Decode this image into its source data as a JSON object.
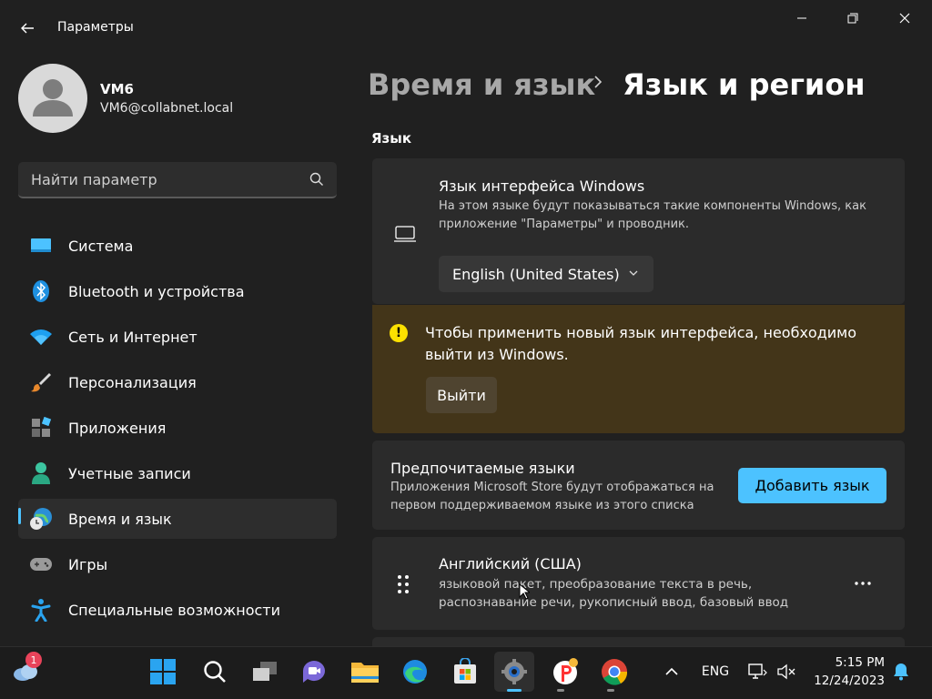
{
  "window": {
    "title": "Параметры",
    "controls": [
      "minimize-icon",
      "maximize-icon",
      "close-icon"
    ]
  },
  "profile": {
    "name": "VM6",
    "email": "VM6@collabnet.local"
  },
  "search": {
    "placeholder": "Найти параметр"
  },
  "nav": {
    "items": [
      {
        "label": "Система",
        "icon": "system-icon"
      },
      {
        "label": "Bluetooth и устройства",
        "icon": "bluetooth-icon"
      },
      {
        "label": "Сеть и Интернет",
        "icon": "wifi-icon"
      },
      {
        "label": "Персонализация",
        "icon": "brush-icon"
      },
      {
        "label": "Приложения",
        "icon": "apps-icon"
      },
      {
        "label": "Учетные записи",
        "icon": "accounts-icon"
      },
      {
        "label": "Время и язык",
        "icon": "time-language-icon",
        "active": true
      },
      {
        "label": "Игры",
        "icon": "gamepad-icon"
      },
      {
        "label": "Специальные возможности",
        "icon": "accessibility-icon"
      }
    ]
  },
  "breadcrumb": {
    "parent": "Время и язык",
    "current": "Язык и регион"
  },
  "language_section": {
    "title": "Язык",
    "display_language": {
      "title": "Язык интерфейса Windows",
      "description": "На этом языке будут показываться такие компоненты Windows, как приложение \"Параметры\" и проводник.",
      "selected": "English (United States)"
    },
    "warning": {
      "text": "Чтобы применить новый язык интерфейса, необходимо выйти из Windows.",
      "button": "Выйти"
    },
    "preferred": {
      "title": "Предпочитаемые языки",
      "description": "Приложения Microsoft Store будут отображаться на первом поддерживаемом языке из этого списка",
      "button": "Добавить язык"
    },
    "languages": [
      {
        "name": "Английский (США)",
        "features": "языковой пакет, преобразование текста в речь, распознавание речи, рукописный ввод, базовый ввод",
        "more_icon": "more-icon"
      }
    ]
  },
  "taskbar": {
    "weather_badge": "1",
    "apps": [
      "start-icon",
      "search-icon",
      "task-view-icon",
      "chat-icon",
      "file-explorer-icon",
      "edge-icon",
      "store-icon",
      "settings-icon",
      "yandex-icon",
      "chrome-icon"
    ],
    "tray": {
      "language": "ENG",
      "time": "5:15 PM",
      "date": "12/24/2023"
    }
  },
  "colors": {
    "accent": "#4cc2ff",
    "background": "#202020",
    "card": "#2b2b2b",
    "warning_bg": "#433519",
    "warning_icon": "#fce100"
  }
}
